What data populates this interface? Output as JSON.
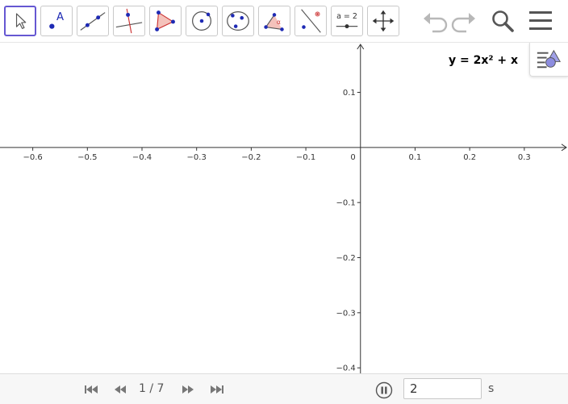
{
  "colors": {
    "accent": "#6557d2",
    "point_blue": "#1e2ab4",
    "tool_red": "#cc3333",
    "polygon_fill": "#f4c2bb",
    "icon_gray": "#555555",
    "disabled_gray": "#b8b8b8",
    "axis": "#333333"
  },
  "toolbar": {
    "tools": [
      {
        "name": "move-tool",
        "icon": "arrow-pointer-icon",
        "active": true
      },
      {
        "name": "point-tool",
        "icon": "point-icon",
        "label": "A"
      },
      {
        "name": "line-tool",
        "icon": "line-through-points-icon"
      },
      {
        "name": "perpendicular-line-tool",
        "icon": "perpendicular-line-icon"
      },
      {
        "name": "polygon-tool",
        "icon": "polygon-icon"
      },
      {
        "name": "circle-tool",
        "icon": "circle-center-point-icon"
      },
      {
        "name": "ellipse-tool",
        "icon": "conic-through-points-icon"
      },
      {
        "name": "angle-tool",
        "icon": "angle-icon",
        "label": "α"
      },
      {
        "name": "reflect-tool",
        "icon": "reflect-about-line-icon"
      },
      {
        "name": "slider-tool",
        "icon": "slider-icon",
        "label": "a = 2"
      },
      {
        "name": "move-graphics-view-tool",
        "icon": "move-arrows-icon"
      }
    ],
    "undo_icon": "undo-icon",
    "redo_icon": "redo-icon",
    "search_icon": "search-icon",
    "menu_icon": "hamburger-menu-icon"
  },
  "graphics": {
    "function_label": "y = 2x² + x",
    "style_bar_icon": "style-bar-toggle-icon",
    "x_axis": {
      "min": -0.66,
      "max": 0.38,
      "ticks": [
        "-0.6",
        "-0.5",
        "-0.4",
        "-0.3",
        "-0.2",
        "-0.1",
        "0.1",
        "0.2",
        "0.3"
      ],
      "tick_values": [
        -0.6,
        -0.5,
        -0.4,
        -0.3,
        -0.2,
        -0.1,
        0.1,
        0.2,
        0.3
      ]
    },
    "y_axis": {
      "min": -0.41,
      "max": 0.19,
      "ticks": [
        "0.1",
        "-0.1",
        "-0.2",
        "-0.3",
        "-0.4"
      ],
      "tick_values": [
        0.1,
        -0.1,
        -0.2,
        -0.3,
        -0.4
      ]
    },
    "origin_label": "0",
    "grid": false
  },
  "playbar": {
    "first_icon": "skip-to-start-icon",
    "prev_icon": "rewind-icon",
    "slide_counter": "1 / 7",
    "next_icon": "fast-forward-icon",
    "last_icon": "skip-to-end-icon",
    "pause_icon": "pause-icon",
    "speed_value": "2",
    "speed_unit": "s"
  }
}
